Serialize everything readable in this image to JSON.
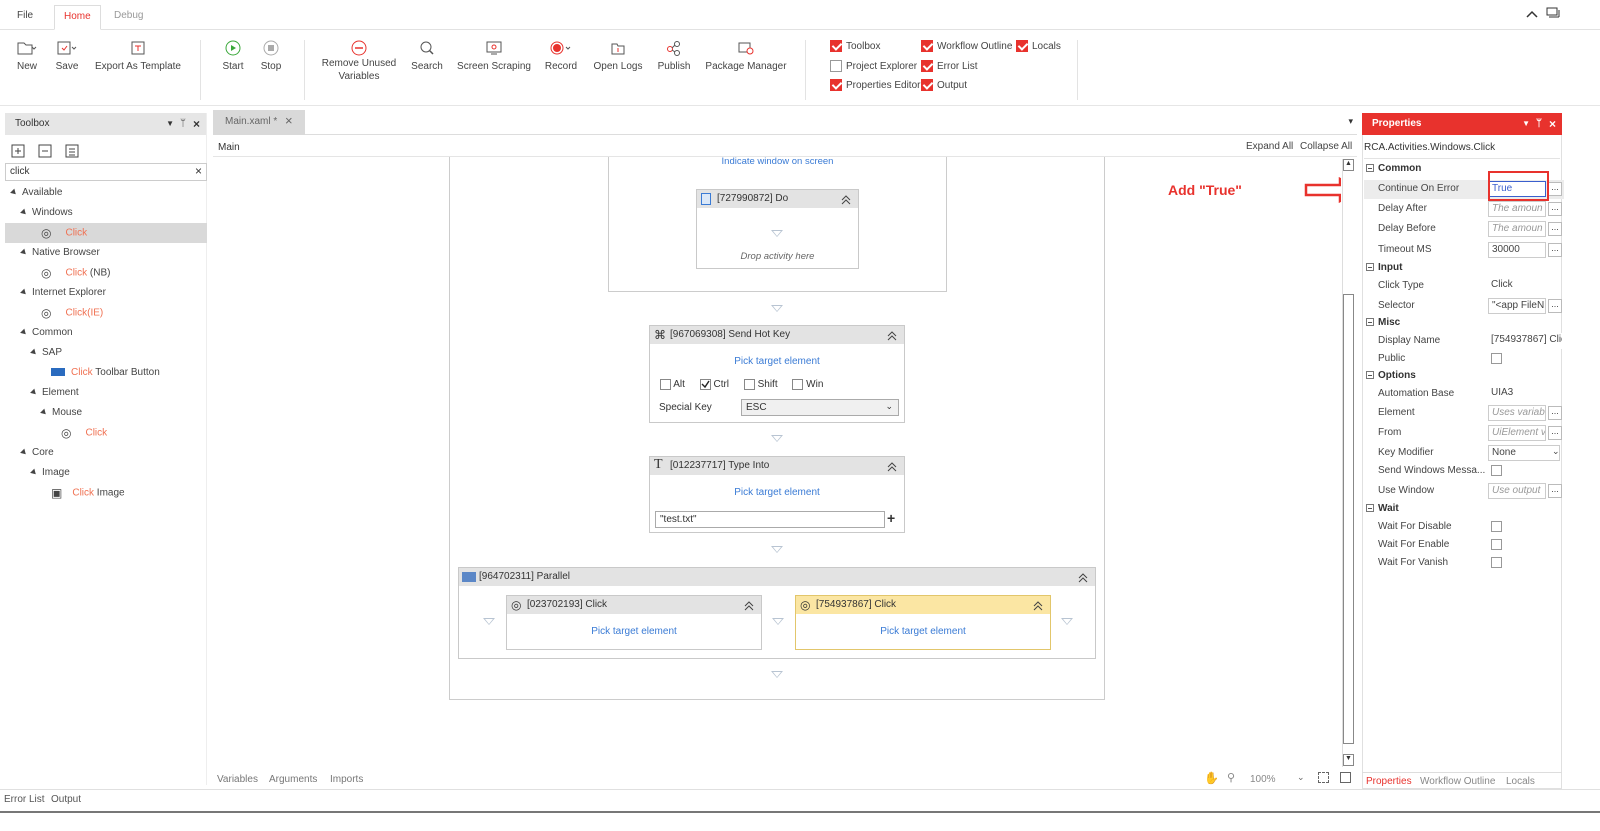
{
  "menu": {
    "file": "File",
    "home": "Home",
    "debug": "Debug"
  },
  "ribbon": {
    "new": "New",
    "save": "Save",
    "export_template": "Export As Template",
    "start": "Start",
    "stop": "Stop",
    "remove_unused_1": "Remove Unused",
    "remove_unused_2": "Variables",
    "search": "Search",
    "screen_scraping": "Screen Scraping",
    "record": "Record",
    "open_logs": "Open Logs",
    "publish": "Publish",
    "package_manager": "Package Manager",
    "toggles": {
      "toolbox": "Toolbox",
      "workflow_outline": "Workflow Outline",
      "locals": "Locals",
      "project_explorer": "Project Explorer",
      "error_list": "Error List",
      "properties_editor": "Properties Editor",
      "output": "Output"
    }
  },
  "toolbox": {
    "title": "Toolbox",
    "search_value": "click",
    "tree": {
      "available": "Available",
      "windows": "Windows",
      "click": "Click",
      "native_browser": "Native Browser",
      "click_nb_suffix": " (NB)",
      "internet_explorer": "Internet Explorer",
      "click_ie_suffix": "(IE)",
      "common": "Common",
      "sap": "SAP",
      "toolbar_button_suffix": " Toolbar Button",
      "element": "Element",
      "mouse": "Mouse",
      "core": "Core",
      "image": "Image",
      "image_suffix": " Image"
    }
  },
  "designer": {
    "tab": "Main.xaml *",
    "breadcrumb": "Main",
    "expand_all": "Expand All",
    "collapse_all": "Collapse All",
    "indicate_window": "Indicate window on screen",
    "do_title": "[727990872] Do",
    "drop_activity": "Drop activity here",
    "hotkey_title": "[967069308] Send Hot Key",
    "pick_target": "Pick target element",
    "alt": "Alt",
    "ctrl": "Ctrl",
    "shift": "Shift",
    "win": "Win",
    "special_key_label": "Special Key",
    "special_key_value": "ESC",
    "typeinto_title": "[012237717] Type Into",
    "typeinto_text": "\"test.txt\"",
    "parallel_title": "[964702311] Parallel",
    "click1_title": "[023702193] Click",
    "click2_title": "[754937867] Click",
    "annotation": "Add \"True\"",
    "bottom_tabs": {
      "variables": "Variables",
      "arguments": "Arguments",
      "imports": "Imports"
    },
    "zoom": "100%"
  },
  "properties": {
    "title": "Properties",
    "type_name": "RCA.Activities.Windows.Click",
    "cat_common": "Common",
    "continue_on_error": "Continue On Error",
    "continue_on_error_value": "True",
    "delay_after": "Delay After",
    "delay_after_value": "The amoun",
    "delay_before": "Delay Before",
    "delay_before_value": "The amoun",
    "timeout_ms": "Timeout MS",
    "timeout_ms_value": "30000",
    "cat_input": "Input",
    "click_type": "Click Type",
    "click_type_value": "Click",
    "selector": "Selector",
    "selector_value": "\"<app FileN",
    "cat_misc": "Misc",
    "display_name": "Display Name",
    "display_name_value": "[754937867] Clic",
    "public": "Public",
    "cat_options": "Options",
    "automation_base": "Automation Base",
    "automation_base_value": "UIA3",
    "element": "Element",
    "element_value": "Uses variab",
    "from": "From",
    "from_value": "UiElement v",
    "key_modifier": "Key Modifier",
    "key_modifier_value": "None",
    "send_windows_messages": "Send Windows Messa...",
    "use_window": "Use Window",
    "use_window_value": "Use output",
    "cat_wait": "Wait",
    "wait_for_disable": "Wait For Disable",
    "wait_for_enable": "Wait For Enable",
    "wait_for_vanish": "Wait For Vanish",
    "bottom_tabs": {
      "properties": "Properties",
      "workflow_outline": "Workflow Outline",
      "locals": "Locals"
    }
  },
  "status": {
    "error_list": "Error List",
    "output": "Output"
  }
}
